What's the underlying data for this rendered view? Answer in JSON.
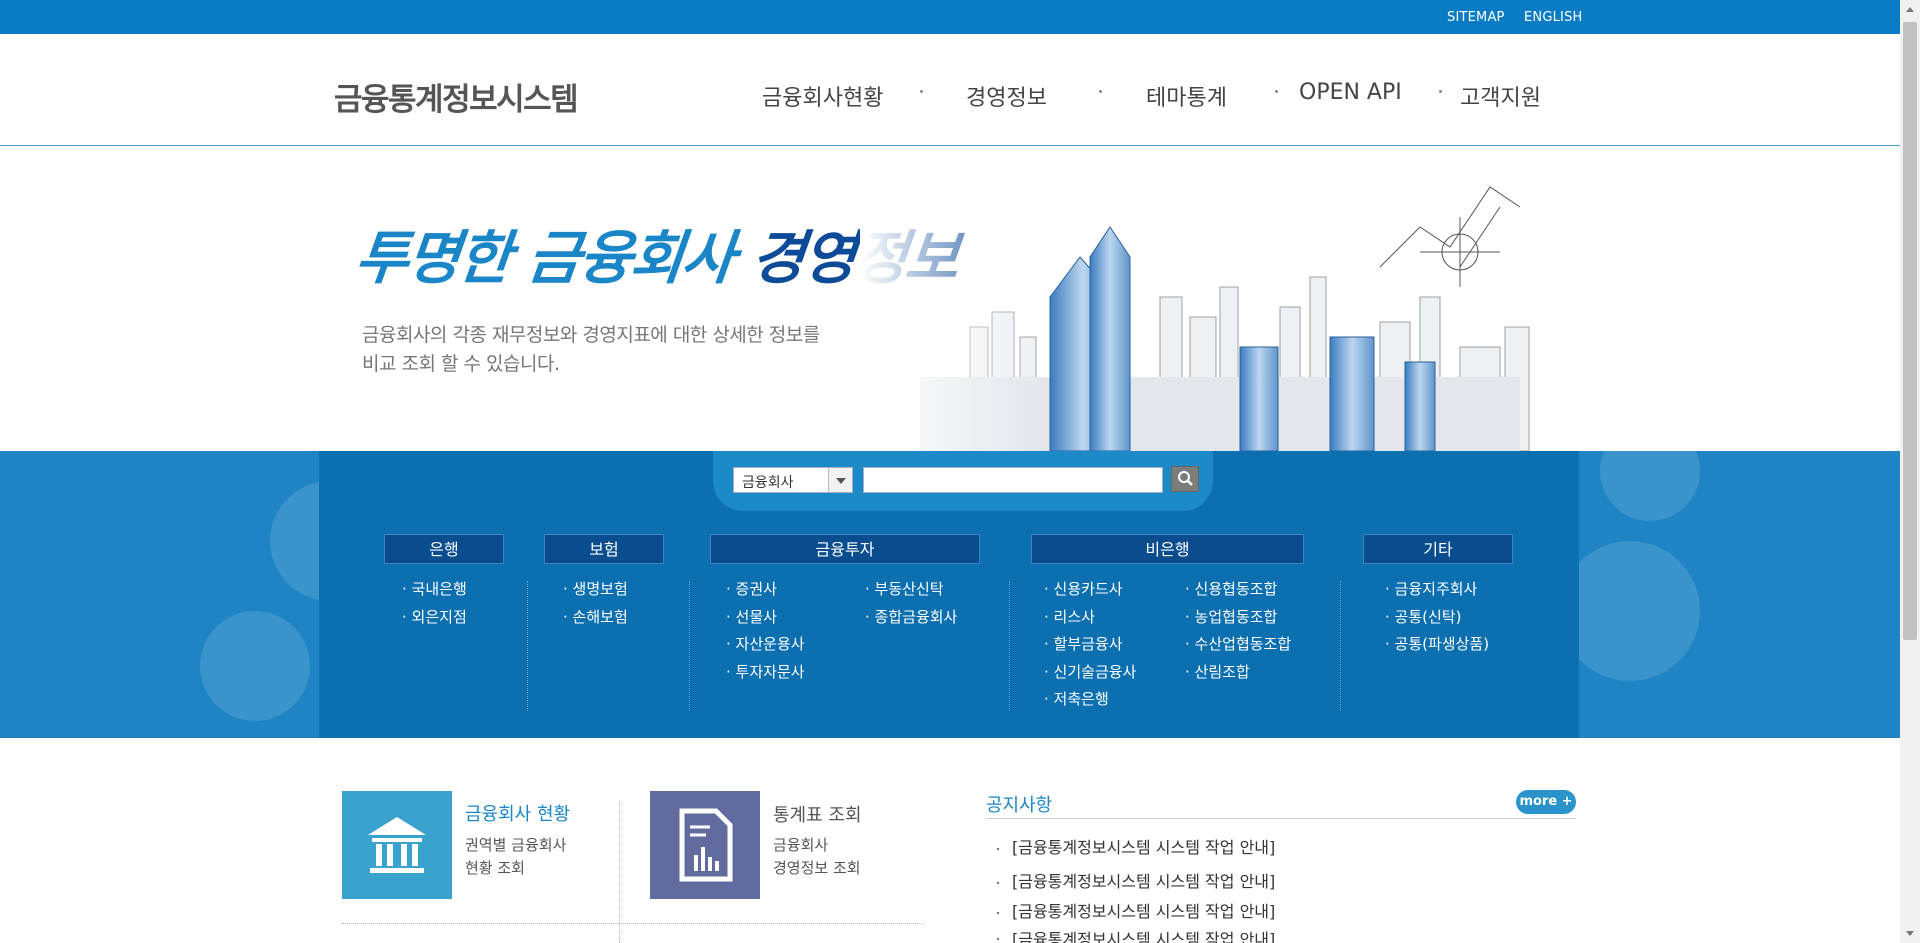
{
  "utility": {
    "sitemap": "SITEMAP",
    "english": "ENGLISH"
  },
  "header": {
    "logo": "금융통계정보시스템",
    "nav": [
      "금융회사현황",
      "경영정보",
      "테마통계",
      "OPEN API",
      "고객지원"
    ]
  },
  "hero": {
    "title_part1": "투명한 금융회사 ",
    "title_part2": "경영정보",
    "desc_line1": "금융회사의 각종 재무정보와 경영지표에 대한 상세한 정보를",
    "desc_line2": "비교 조회 할 수 있습니다."
  },
  "search": {
    "select_value": "금융회사",
    "placeholder": ""
  },
  "categories": {
    "bank": {
      "label": "은행",
      "items": [
        "국내은행",
        "외은지점"
      ]
    },
    "insurance": {
      "label": "보험",
      "items": [
        "생명보험",
        "손해보험"
      ]
    },
    "investment": {
      "label": "금융투자",
      "col1": [
        "증권사",
        "선물사",
        "자산운용사",
        "투자자문사"
      ],
      "col2": [
        "부동산신탁",
        "종합금융회사"
      ]
    },
    "nonbank": {
      "label": "비은행",
      "col1": [
        "신용카드사",
        "리스사",
        "할부금융사",
        "신기술금융사",
        "저축은행"
      ],
      "col2": [
        "신용협동조합",
        "농업협동조합",
        "수산업협동조합",
        "산림조합"
      ]
    },
    "etc": {
      "label": "기타",
      "items": [
        "금융지주회사",
        "공통(신탁)",
        "공통(파생상품)"
      ]
    }
  },
  "quick": {
    "company": {
      "title": "금융회사 현황",
      "desc1": "권역별 금융회사",
      "desc2": "현황 조회"
    },
    "stats": {
      "title": "통계표 조회",
      "desc1": "금융회사",
      "desc2": "경영정보 조회"
    }
  },
  "notice": {
    "title": "공지사항",
    "more": "more +",
    "items": [
      "[금융통계정보시스템 시스템 작업 안내]",
      "[금융통계정보시스템 시스템 작업 안내]",
      "[금융통계정보시스템 시스템 작업 안내]",
      "[금융통계정보시스템 시스템 작업 안내]"
    ]
  },
  "colors": {
    "brand_blue": "#0a7cc4",
    "band_blue": "#1f84c4",
    "dark_blue": "#0a4d8f",
    "quick_teal": "#3aa2cf",
    "quick_purple": "#616b9e"
  },
  "icons": [
    "search-icon",
    "bank-building-icon",
    "document-chart-icon"
  ]
}
